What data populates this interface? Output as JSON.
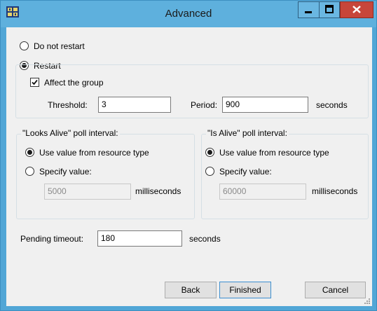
{
  "window": {
    "title": "Advanced",
    "icon": "app-icon"
  },
  "restart_options": {
    "do_not_restart_label": "Do not restart",
    "restart_label": "Restart",
    "selected": "restart"
  },
  "restart_group": {
    "affect_group_label": "Affect the group",
    "affect_group_checked": true,
    "threshold_label": "Threshold:",
    "threshold_value": "3",
    "period_label": "Period:",
    "period_value": "900",
    "period_unit": "seconds"
  },
  "looks_alive": {
    "legend": "\"Looks Alive\" poll interval:",
    "use_resource_label": "Use value from resource type",
    "specify_label": "Specify value:",
    "selected": "use_resource",
    "value": "5000",
    "unit": "milliseconds"
  },
  "is_alive": {
    "legend": "\"Is Alive\" poll interval:",
    "use_resource_label": "Use value from resource type",
    "specify_label": "Specify value:",
    "selected": "use_resource",
    "value": "60000",
    "unit": "milliseconds"
  },
  "pending": {
    "label": "Pending timeout:",
    "value": "180",
    "unit": "seconds"
  },
  "buttons": {
    "back": "Back",
    "finished": "Finished",
    "cancel": "Cancel"
  },
  "colors": {
    "frame": "#51a6d6",
    "close": "#c7463a",
    "client": "#f0f0f0"
  }
}
